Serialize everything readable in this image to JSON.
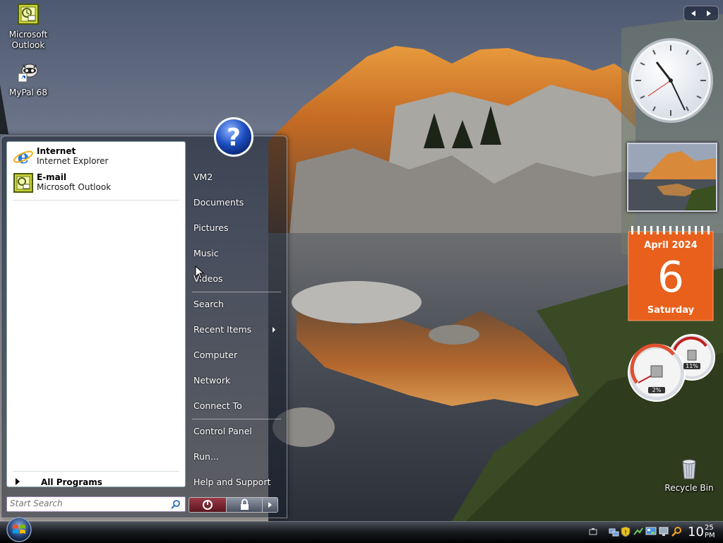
{
  "desktop": {
    "icons": [
      {
        "label_line1": "Microsoft",
        "label_line2": "Outlook",
        "icon": "outlook-icon"
      },
      {
        "label_line1": "MyPal 68",
        "icon": "mypal-icon"
      }
    ],
    "recycle_bin": {
      "label": "Recycle Bin",
      "icon": "recycle-bin-icon"
    }
  },
  "start_menu": {
    "pinned": [
      {
        "title": "Internet",
        "subtitle": "Internet Explorer",
        "icon": "internet-explorer-icon"
      },
      {
        "title": "E-mail",
        "subtitle": "Microsoft Outlook",
        "icon": "outlook-icon"
      }
    ],
    "all_programs_label": "All Programs",
    "search_placeholder": "Start Search",
    "right_items": [
      "VM2",
      "Documents",
      "Pictures",
      "Music",
      "Videos",
      "Search",
      "Recent Items",
      "Computer",
      "Network",
      "Connect To",
      "Control Panel",
      "Run...",
      "Help and Support"
    ],
    "help_icon": "help-question-icon",
    "power_icon": "power-icon",
    "lock_icon": "lock-icon",
    "more_options_icon": "arrow-right-icon"
  },
  "gadgets": {
    "calendar": {
      "month_year": "April 2024",
      "day": "6",
      "weekday": "Saturday",
      "color": "#e8601c"
    },
    "meter": {
      "cpu_percent": "2%",
      "memory_percent": "11%"
    }
  },
  "taskbar": {
    "clock_hour": "10",
    "clock_minute": "25",
    "clock_ampm": "PM"
  },
  "colors": {
    "taskbar": "#1a1d22",
    "start_menu_left": "#ffffff",
    "calendar_orange": "#e8601c"
  }
}
